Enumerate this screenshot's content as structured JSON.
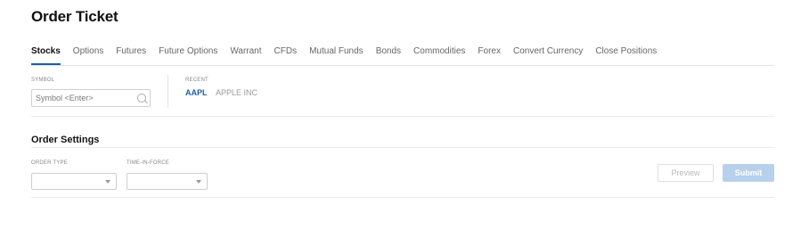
{
  "page": {
    "title": "Order Ticket"
  },
  "tabs": [
    {
      "label": "Stocks",
      "active": true
    },
    {
      "label": "Options",
      "active": false
    },
    {
      "label": "Futures",
      "active": false
    },
    {
      "label": "Future Options",
      "active": false
    },
    {
      "label": "Warrant",
      "active": false
    },
    {
      "label": "CFDs",
      "active": false
    },
    {
      "label": "Mutual Funds",
      "active": false
    },
    {
      "label": "Bonds",
      "active": false
    },
    {
      "label": "Commodities",
      "active": false
    },
    {
      "label": "Forex",
      "active": false
    },
    {
      "label": "Convert Currency",
      "active": false
    },
    {
      "label": "Close Positions",
      "active": false
    }
  ],
  "symbol": {
    "label": "SYMBOL",
    "placeholder": "Symbol <Enter>",
    "icon": "search-icon"
  },
  "recent": {
    "label": "RECENT",
    "items": [
      {
        "symbol": "AAPL",
        "name": "APPLE INC"
      }
    ]
  },
  "order_settings": {
    "title": "Order Settings",
    "order_type_label": "ORDER TYPE",
    "order_type_value": "",
    "tif_label": "TIME-IN-FORCE",
    "tif_value": "",
    "preview_label": "Preview",
    "submit_label": "Submit"
  },
  "colors": {
    "accent": "#1b5fa8",
    "submit_bg": "#b7d0ec"
  }
}
